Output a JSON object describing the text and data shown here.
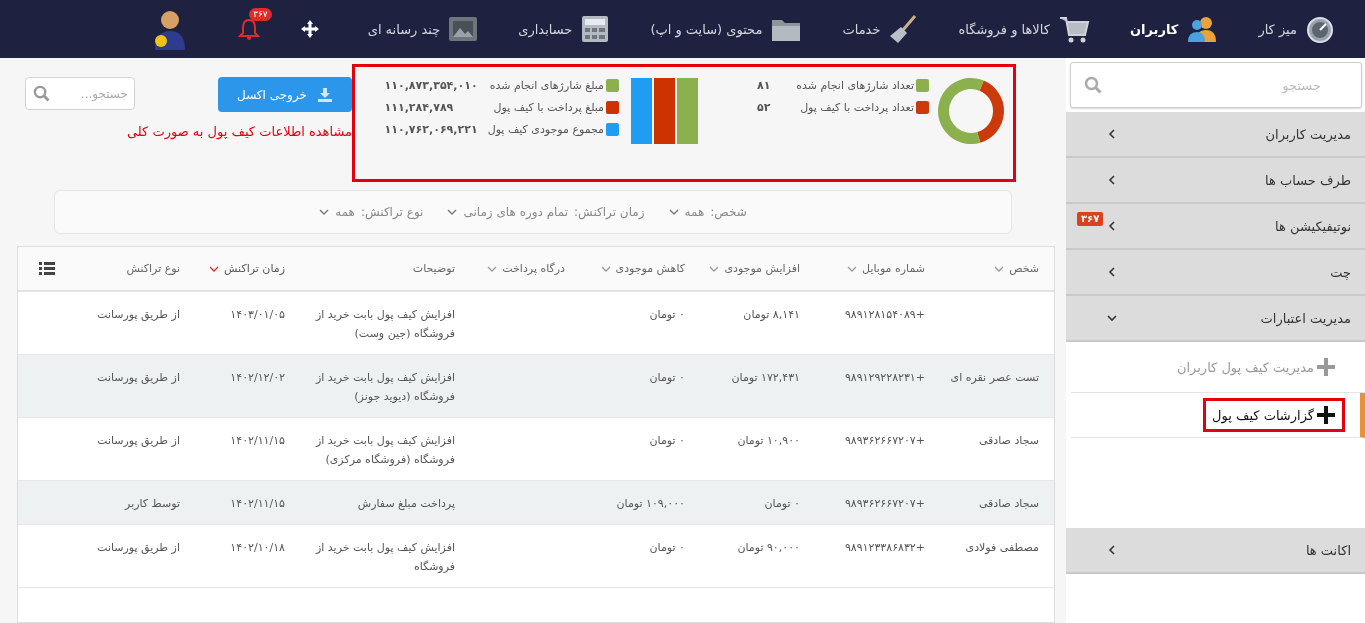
{
  "topbar": {
    "items": [
      {
        "label": "میز کار",
        "selected": false
      },
      {
        "label": "کاربران",
        "selected": true
      },
      {
        "label": "کالاها و فروشگاه",
        "selected": false
      },
      {
        "label": "خدمات",
        "selected": false
      },
      {
        "label": "محتوی (سایت و اپ)",
        "selected": false
      },
      {
        "label": "حسابداری",
        "selected": false
      },
      {
        "label": "چند رسانه ای",
        "selected": false
      }
    ],
    "notification_badge": "۳۶۷"
  },
  "sidebar": {
    "search": {
      "placeholder": "جستجو"
    },
    "items": [
      {
        "label": "مدیریت کاربران",
        "expanded": false
      },
      {
        "label": "طرف حساب ها",
        "expanded": false
      },
      {
        "label": "نوتیفیکیشن ها",
        "expanded": false,
        "badge": "۳۶۷"
      },
      {
        "label": "چت",
        "expanded": false
      },
      {
        "label": "مدیریت اعتبارات",
        "expanded": true,
        "children": [
          {
            "label": "مدیریت کیف پول کاربران",
            "selected": false,
            "highlighted": false
          },
          {
            "label": "گزارشات کیف پول",
            "selected": true,
            "highlighted": true
          }
        ]
      },
      {
        "label": "اکانت ها",
        "expanded": false
      }
    ]
  },
  "toolbar": {
    "search": {
      "placeholder": "جستجو..."
    },
    "export_button": "خروجی اکسل",
    "annotation": "مشاهده اطلاعات کیف پول به صورت کلی"
  },
  "summary": {
    "highlighted": true,
    "counts": [
      {
        "value": "۸۱",
        "color": "#8db04f"
      },
      {
        "value": "۵۲",
        "color": "#cc3a0c"
      }
    ],
    "chart_data": {
      "type": "donut",
      "categories": [
        "تعداد شارژهای انجام شده",
        "تعداد پرداخت با کیف پول"
      ],
      "values": [
        60.9,
        39.1
      ]
    },
    "amounts": [
      {
        "label": "مبلغ شارژهای انجام شده",
        "value": "۱۱۰,۸۷۳,۳۵۴,۰۱۰",
        "color": "#8db04f"
      },
      {
        "label": "مبلغ پرداخت با کیف پول",
        "value": "۱۱۱,۲۸۴,۷۸۹",
        "color": "#cc3300"
      },
      {
        "label": "مجموع موجودی کیف پول",
        "value": "۱۱۰,۷۶۲,۰۶۹,۲۲۱",
        "color": "#1e9df2"
      }
    ]
  },
  "filters": [
    {
      "label": "شخص:",
      "value": "همه"
    },
    {
      "label": "زمان تراکنش:",
      "value": "تمام دوره های زمانی"
    },
    {
      "label": "نوع تراکنش:",
      "value": "همه"
    }
  ],
  "table": {
    "columns": [
      {
        "label": "شخص",
        "sortable": true,
        "sorted": false
      },
      {
        "label": "شماره موبایل",
        "sortable": true,
        "sorted": false
      },
      {
        "label": "افزایش موجودی",
        "sortable": true,
        "sorted": false
      },
      {
        "label": "کاهش موجودی",
        "sortable": true,
        "sorted": false
      },
      {
        "label": "درگاه پرداخت",
        "sortable": true,
        "sorted": false
      },
      {
        "label": "توضیحات",
        "sortable": false,
        "sorted": false
      },
      {
        "label": "زمان تراکنش",
        "sortable": true,
        "sorted": true
      },
      {
        "label": "نوع تراکنش",
        "sortable": false,
        "sorted": false
      }
    ],
    "rows": [
      {
        "mobile": "+۹۸۹۱۲۸۱۵۴۰۸۹",
        "increase": "۸,۱۴۱ تومان",
        "decrease": "۰ تومان",
        "description": "افزایش کیف پول بابت خرید از فروشگاه (جین وست)",
        "time": "۱۴۰۳/۰۱/۰۵",
        "type": "از طریق پورسانت"
      },
      {
        "person": "تست عصر نقره ای",
        "mobile": "+۹۸۹۱۲۹۲۲۸۲۳۱",
        "increase": "۱۷۲,۴۳۱ تومان",
        "decrease": "۰ تومان",
        "description": "افزایش کیف پول بابت خرید از فروشگاه (دیوید جونز)",
        "time": "۱۴۰۲/۱۲/۰۲",
        "type": "از طریق پورسانت"
      },
      {
        "person": "سجاد صادقی",
        "mobile": "+۹۸۹۳۶۲۶۶۷۲۰۷",
        "increase": "۱۰,۹۰۰ تومان",
        "decrease": "۰ تومان",
        "description": "افزایش کیف پول بابت خرید از فروشگاه (فروشگاه مرکزی)",
        "time": "۱۴۰۲/۱۱/۱۵",
        "type": "از طریق پورسانت"
      },
      {
        "person": "سجاد صادقی",
        "mobile": "+۹۸۹۳۶۲۶۶۷۲۰۷",
        "increase": "۰ تومان",
        "decrease": "۱۰۹,۰۰۰ تومان",
        "description": "پرداخت مبلغ سفارش",
        "time": "۱۴۰۲/۱۱/۱۵",
        "type": "توسط کاربر"
      },
      {
        "person": "مصطفی فولادی",
        "mobile": "+۹۸۹۱۲۳۳۸۶۸۳۲",
        "increase": "۹۰,۰۰۰ تومان",
        "decrease": "۰ تومان",
        "description": "افزایش کیف پول بابت خرید از فروشگاه",
        "time": "۱۴۰۲/۱۰/۱۸",
        "type": "از طریق پورسانت"
      }
    ]
  }
}
